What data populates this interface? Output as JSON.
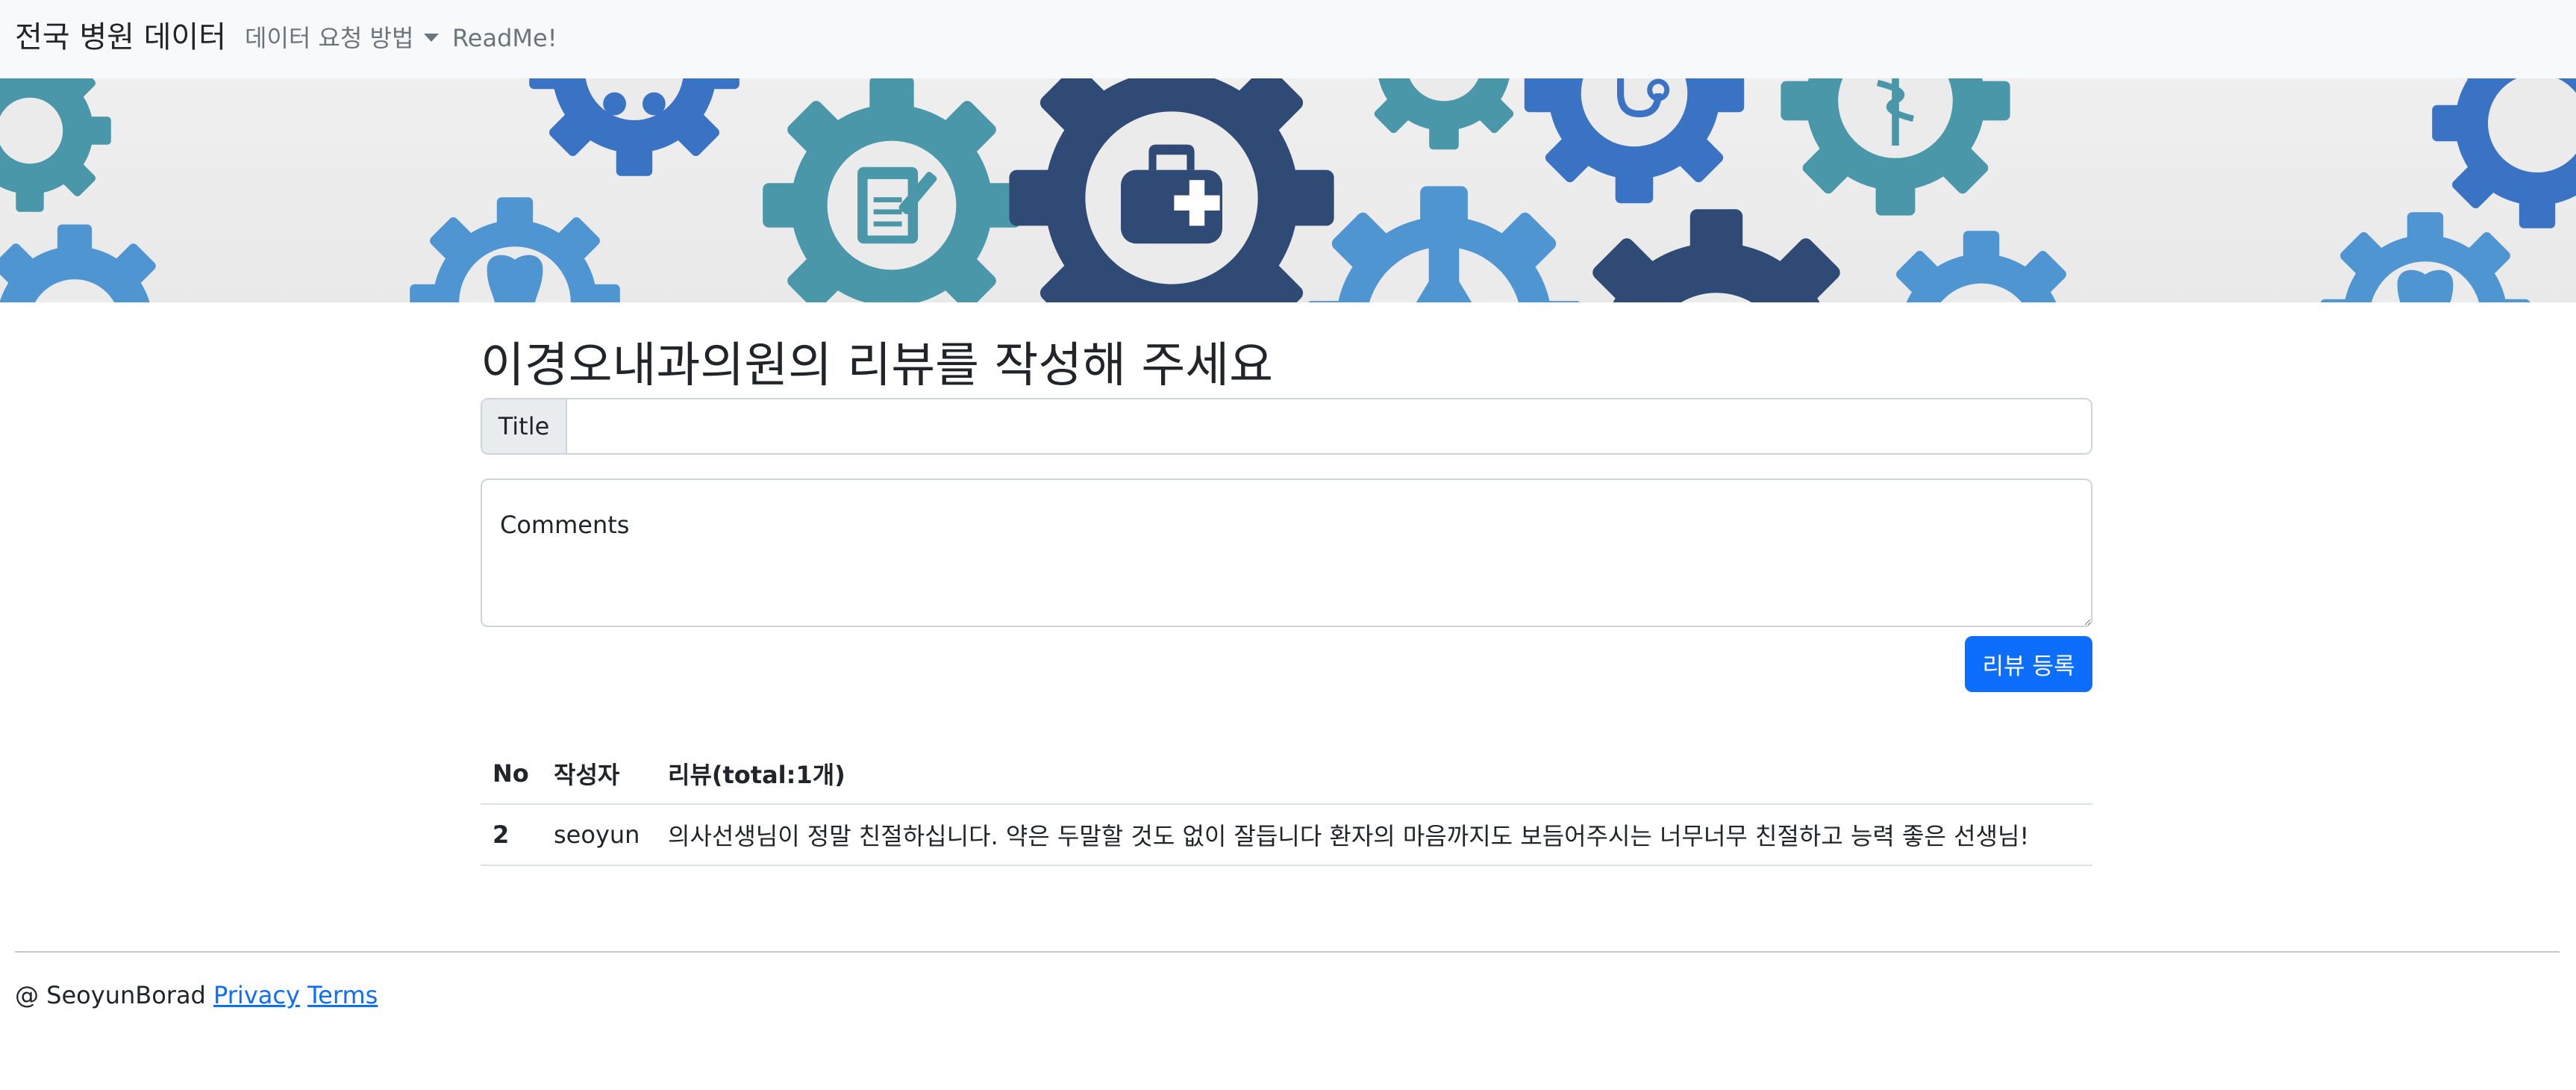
{
  "navbar": {
    "brand": "전국 병원 데이터",
    "dropdown_label": "데이터 요청 방법",
    "readme_label": "ReadMe!"
  },
  "banner": {
    "icons": [
      "tooth-icon",
      "document-icon",
      "medical-bag-icon",
      "flask-icon",
      "stethoscope-icon",
      "caduceus-icon",
      "tooth-icon",
      "gear-icon"
    ],
    "colors": {
      "teal": "#4a97aa",
      "blue": "#3b73c4",
      "navy": "#2f4a74",
      "lightblue": "#4f95d2"
    }
  },
  "form": {
    "heading": "이경오내과의원의 리뷰를 작성해 주세요",
    "title_addon": "Title",
    "title_value": "",
    "comments_placeholder": "Comments",
    "submit_label": "리뷰 등록"
  },
  "reviews": {
    "headers": {
      "no": "No",
      "author": "작성자",
      "review": "리뷰(total:1개)"
    },
    "rows": [
      {
        "no": "2",
        "author": "seoyun",
        "text": "의사선생님이 정말 친절하십니다. 약은 두말할 것도 없이 잘듭니다 환자의 마음까지도 보듬어주시는 너무너무 친절하고 능력 좋은 선생님!"
      }
    ]
  },
  "footer": {
    "copyright": "@ SeoyunBorad",
    "privacy": "Privacy",
    "terms": "Terms"
  }
}
